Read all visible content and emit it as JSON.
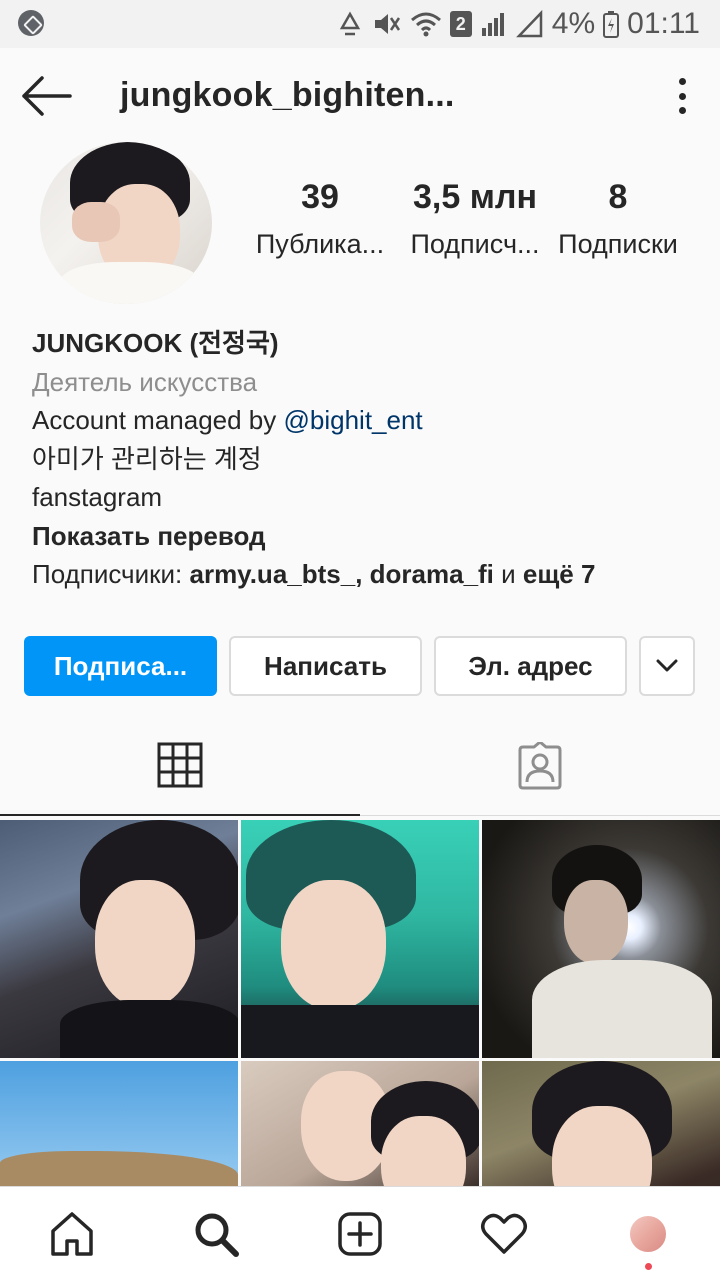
{
  "status_bar": {
    "sim_slot": "2",
    "battery": "4%",
    "time": "01:11"
  },
  "header": {
    "username": "jungkook_bighiten..."
  },
  "profile": {
    "stats": [
      {
        "value": "39",
        "label": "Публика..."
      },
      {
        "value": "3,5 млн",
        "label": "Подписч..."
      },
      {
        "value": "8",
        "label": "Подписки"
      }
    ],
    "bio": {
      "name": "JUNGKOOK (전정국)",
      "category": "Деятель искусства",
      "line1_prefix": "Account managed by ",
      "line1_mention": "@bighit_ent",
      "line2": "아미가 관리하는 계정",
      "line3": "fanstagram",
      "translate": "Показать перевод",
      "followers_prefix": "Подписчики: ",
      "followers_names": "army.ua_bts_, dorama_fi",
      "followers_and": " и ",
      "followers_more": "ещё 7"
    }
  },
  "actions": {
    "follow": "Подписа...",
    "message": "Написать",
    "email": "Эл. адрес"
  },
  "tabs": [
    "grid-tab",
    "tagged-tab"
  ],
  "colors": {
    "accent": "#0095f6",
    "mention": "#003569",
    "muted": "#8e8e8e",
    "text": "#262626",
    "notification": "#ed4956"
  }
}
